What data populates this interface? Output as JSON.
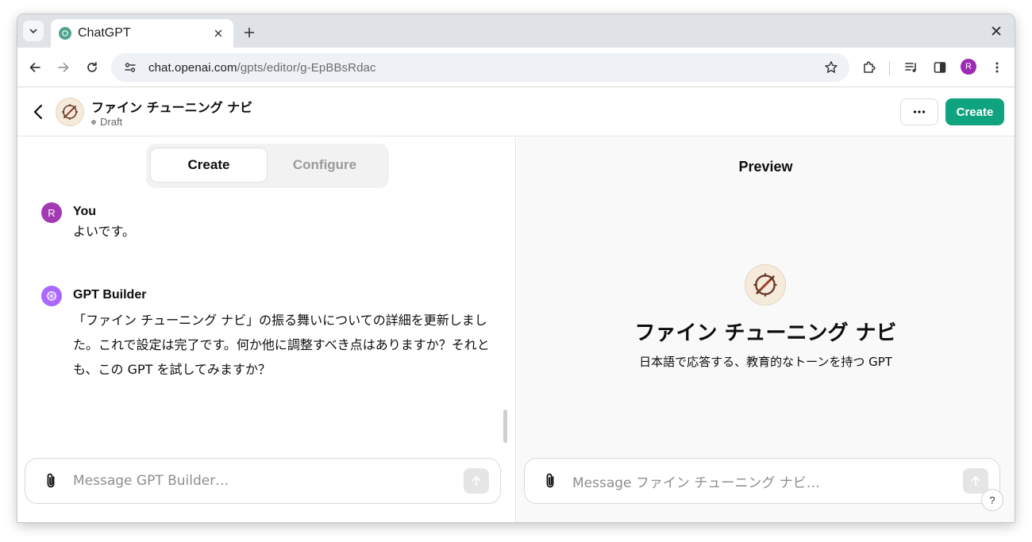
{
  "browser": {
    "tab_title": "ChatGPT",
    "url_host": "chat.openai.com",
    "url_path": "/gpts/editor/g-EpBBsRdac",
    "profile_initial": "R"
  },
  "header": {
    "gpt_name": "ファイン チューニング ナビ",
    "status": "Draft",
    "create_button": "Create"
  },
  "editor": {
    "tabs": [
      {
        "label": "Create",
        "active": true
      },
      {
        "label": "Configure",
        "active": false
      }
    ],
    "messages": [
      {
        "author": "You",
        "avatar_initial": "R",
        "avatar_color": "#a23ab4",
        "text": "よいです。"
      },
      {
        "author": "GPT Builder",
        "avatar_color": "#ab68ff",
        "text": "「ファイン チューニング ナビ」の振る舞いについての詳細を更新しました。これで設定は完了です。何か他に調整すべき点はありますか？それとも、この GPT を試してみますか？"
      }
    ],
    "composer_placeholder": "Message GPT Builder…"
  },
  "preview": {
    "title": "Preview",
    "gpt_name": "ファイン チューニング ナビ",
    "description": "日本語で応答する、教育的なトーンを持つ GPT",
    "composer_placeholder": "Message ファイン チューニング ナビ…",
    "help_label": "?"
  },
  "colors": {
    "accent": "#10a37f",
    "user_avatar": "#a23ab4",
    "builder_avatar": "#ab68ff"
  },
  "icons": [
    "tab-search-icon",
    "openai-favicon",
    "close-icon",
    "plus-icon",
    "back-arrow-icon",
    "forward-arrow-icon",
    "reload-icon",
    "site-settings-icon",
    "bookmark-star-icon",
    "extensions-icon",
    "media-icon",
    "side-panel-icon",
    "kebab-menu-icon",
    "chevron-left-icon",
    "compass-logo",
    "ellipsis-icon",
    "paperclip-icon",
    "arrow-up-icon",
    "openai-logo"
  ]
}
